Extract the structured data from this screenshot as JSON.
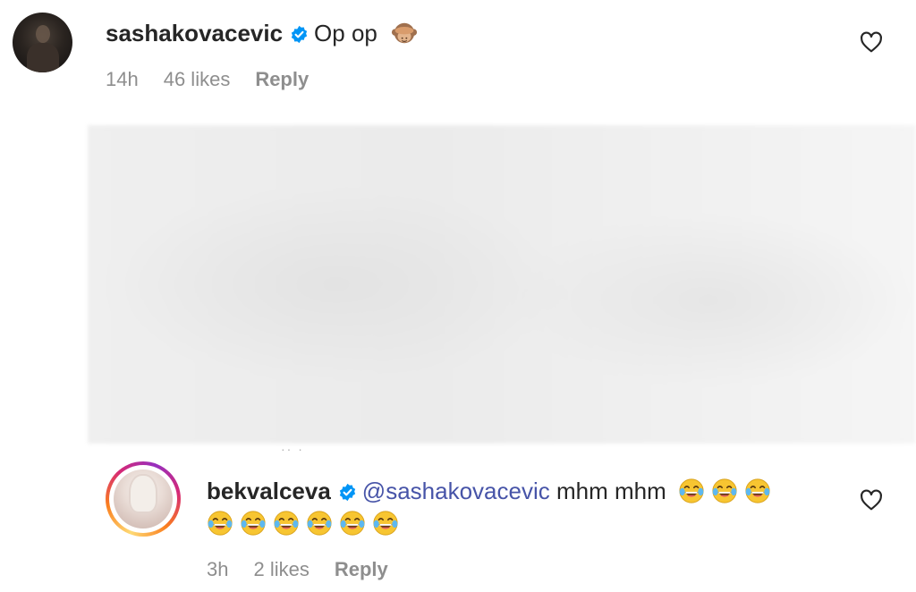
{
  "comments": [
    {
      "username": "sashakovacevic",
      "verified": true,
      "text": "Op op",
      "emoji": "see-no-evil-monkey",
      "time": "14h",
      "likes": "46 likes",
      "reply_label": "Reply"
    },
    {
      "username": "bekvalceva",
      "verified": true,
      "mention": "@sashakovacevic",
      "text": "mhm mhm",
      "emoji": "face-with-tears-of-joy",
      "emoji_count_line1": 3,
      "emoji_count_line2": 6,
      "time": "3h",
      "likes": "2 likes",
      "reply_label": "Reply"
    }
  ],
  "colors": {
    "verified_badge": "#0095f6",
    "mention": "#4754a8",
    "meta_text": "#8e8e8e"
  },
  "icons": {
    "like": "heart-outline-icon",
    "verified": "verified-badge-icon"
  }
}
